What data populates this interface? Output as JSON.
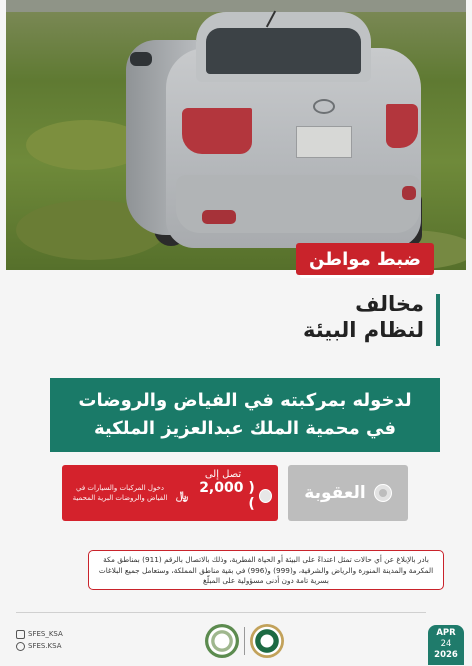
{
  "tag": {
    "label": "ضبط مواطن"
  },
  "title": {
    "line1": "مخالف",
    "line2": "لنظام البيئة"
  },
  "banner": {
    "text": "لدخوله بمركبته في الفياض والروضات في محمية الملك عبدالعزيز الملكية"
  },
  "penalty": {
    "label": "العقوبة",
    "reach": "تصل إلى",
    "amount": "( 2,000 )",
    "currency": "﷼",
    "note": "دخول المركبات والسيارات في الفياض والروضات البرية المحمية"
  },
  "notice": {
    "text": "بادر بالإبلاغ عن أي حالات تمثل اعتداءً على البيئة أو الحياة الفطرية، وذلك بالاتصال بالرقم (911) بمناطق مكة المكرمة والمدينة المنورة والرياض والشرقية، و(999) و(996) في بقية مناطق المملكة، وستعامل جميع البلاغات بسرية تامة دون أدنى مسؤولية على المبلّغ"
  },
  "footer": {
    "social_x": "SFES_KSA",
    "social_ig": "SFES.KSA",
    "date_month": "APR",
    "date_day": "24",
    "date_year": "2026"
  },
  "colors": {
    "red": "#c9232b",
    "green": "#1a7a68",
    "gray": "#bdbdbd"
  },
  "icons": [
    "x-logo-icon",
    "instagram-icon",
    "environment-emblem-icon",
    "ministry-emblem-icon",
    "penalty-icon",
    "coin-icon"
  ]
}
